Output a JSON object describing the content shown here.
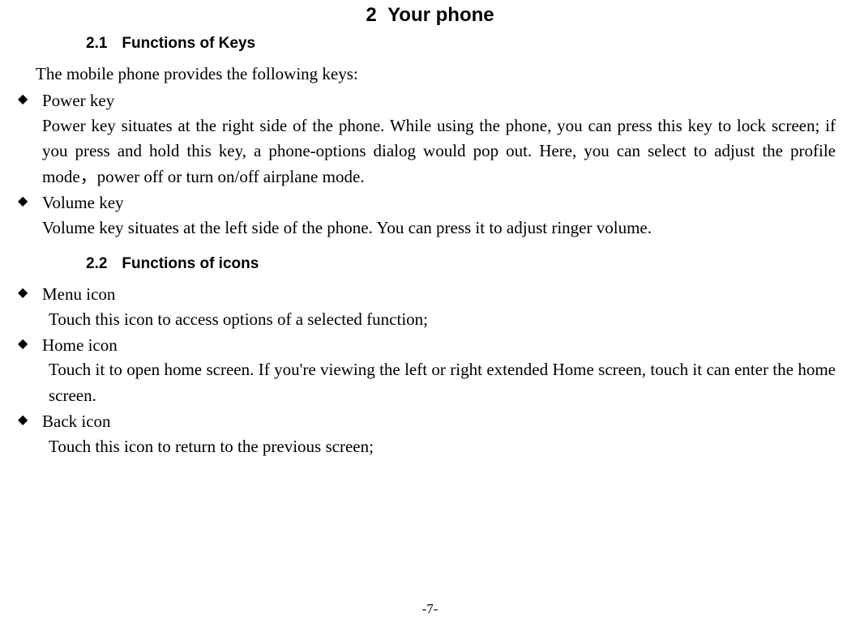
{
  "chapter": {
    "number": "2",
    "title": "Your phone"
  },
  "section1": {
    "number": "2.1",
    "title": "Functions of Keys",
    "intro": "The mobile phone provides the following keys:",
    "items": [
      {
        "term": "Power key",
        "desc": "Power key situates at the right side of the phone. While using the phone, you can press this key to lock screen; if you press and hold this key, a phone-options dialog would pop out. Here, you can select to adjust the profile mode，power off or turn on/off airplane mode."
      },
      {
        "term": "Volume key",
        "desc": "Volume key situates at the left side of the phone. You can press it to adjust ringer volume."
      }
    ]
  },
  "section2": {
    "number": "2.2",
    "title": "Functions of icons",
    "items": [
      {
        "term": "Menu icon",
        "desc": "Touch this icon to access options of a selected function;"
      },
      {
        "term": "Home icon",
        "desc": "Touch it to open home screen. If you're viewing the left or right extended Home screen, touch it can enter the home screen."
      },
      {
        "term": "Back icon",
        "desc": "Touch this icon to return to the previous screen;"
      }
    ]
  },
  "page_number": "-7-"
}
